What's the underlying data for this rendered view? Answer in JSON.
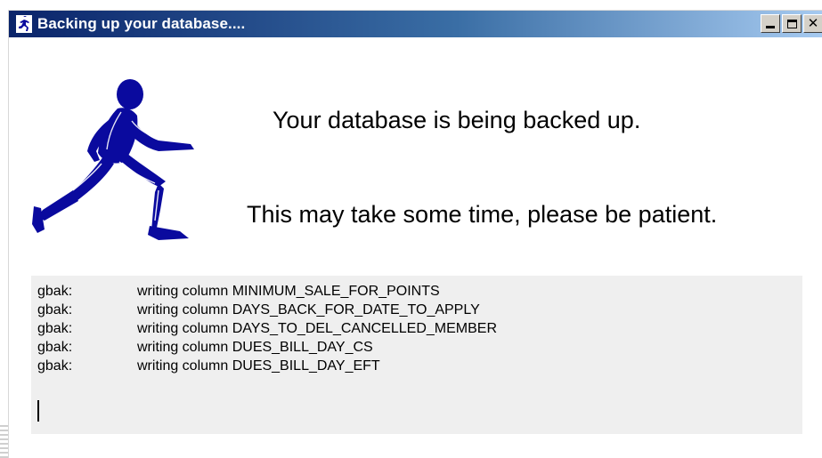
{
  "window": {
    "title": "Backing up your database....",
    "title_icon": "runner-icon",
    "controls": {
      "minimize_icon": "minimize-icon",
      "maximize_icon": "maximize-icon",
      "close_icon": "close-icon"
    }
  },
  "main": {
    "illustration": "running-man-icon",
    "illustration_color": "#0a0a9e",
    "message_primary": "Your database is being backed up.",
    "message_secondary": "This may take some time, please be patient."
  },
  "log": {
    "lines": [
      {
        "prefix": "gbak:",
        "text": "writing column MINIMUM_SALE_FOR_POINTS"
      },
      {
        "prefix": "gbak:",
        "text": "writing column DAYS_BACK_FOR_DATE_TO_APPLY"
      },
      {
        "prefix": "gbak:",
        "text": "writing column DAYS_TO_DEL_CANCELLED_MEMBER"
      },
      {
        "prefix": "gbak:",
        "text": "writing column DUES_BILL_DAY_CS"
      },
      {
        "prefix": "gbak:",
        "text": "writing column DUES_BILL_DAY_EFT"
      }
    ]
  },
  "colors": {
    "titlebar_start": "#0a246a",
    "titlebar_end": "#a6caf0",
    "log_background": "#efefef"
  }
}
